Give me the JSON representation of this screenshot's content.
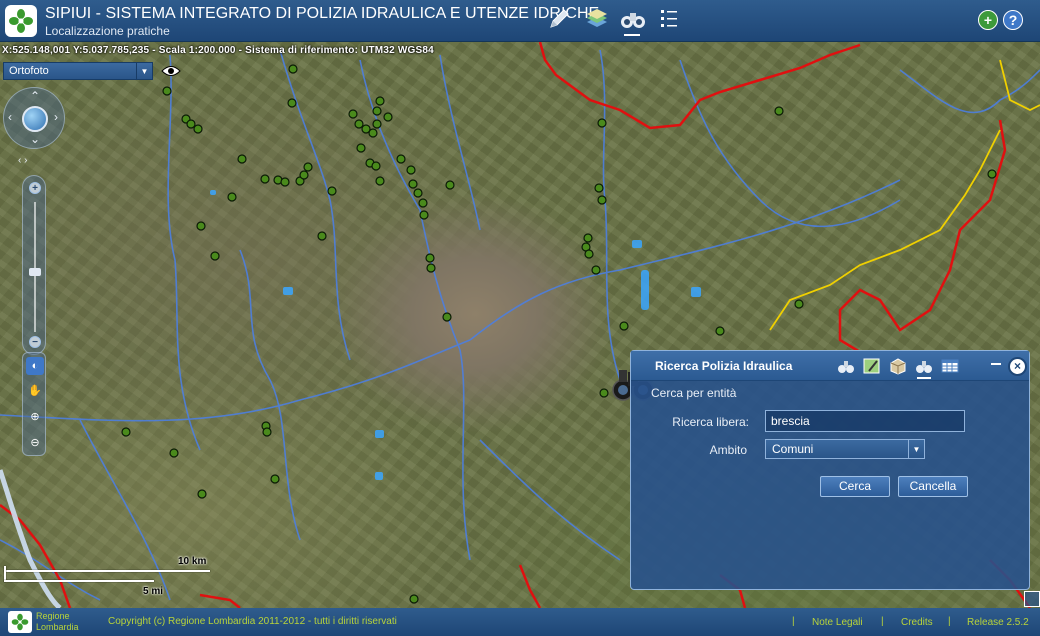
{
  "header": {
    "title": "SIPIUI - SISTEMA INTEGRATO DI POLIZIA IDRAULICA E UTENZE IDRICHE",
    "subtitle": "Localizzazione pratiche",
    "toolbar_icons": [
      "pencil-icon",
      "layers-icon",
      "binoculars-icon",
      "list-icon"
    ],
    "right_icons": [
      "add-icon",
      "help-icon"
    ]
  },
  "map": {
    "coords": "X:525.148,001 Y:5.037.785,235 - Scala 1:200.000 - Sistema di riferimento: UTM32 WGS84",
    "layer": {
      "selected": "Ortofoto"
    },
    "scale": {
      "km": "10 km",
      "mi": "5 mi"
    }
  },
  "dialog": {
    "title": "Ricerca Polizia Idraulica",
    "section": "Cerca per entità",
    "search_label": "Ricerca libera:",
    "search_value": "brescia",
    "ambito_label": "Ambito",
    "ambito_value": "Comuni",
    "search_button": "Cerca",
    "cancel_button": "Cancella",
    "icons": [
      "binoculars-icon",
      "map-edit-icon",
      "box-icon",
      "binoculars-icon",
      "table-icon"
    ]
  },
  "footer": {
    "logo_line1": "Regione",
    "logo_line2": "Lombardia",
    "copyright": "Copyright (c) Regione Lombardia 2011-2012 - tutti i diritti riservati",
    "links": [
      "Note Legali",
      "Credits"
    ],
    "release": "Release 2.5.2"
  },
  "colors": {
    "header": "#2f5c8d",
    "dialog": "#28528c",
    "points": "#4a8a1c",
    "boundary": "#e01010",
    "river": "#4d7fe0",
    "footer_text": "#b8d33a"
  }
}
